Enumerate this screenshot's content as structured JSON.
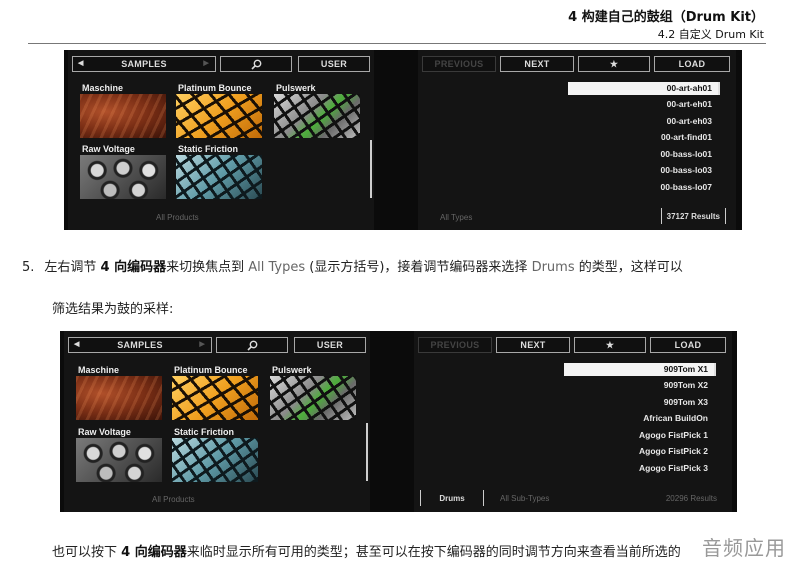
{
  "header": {
    "chapter_title": "4 构建自己的鼓组（Drum Kit）",
    "section_title": "4.2 自定义 Drum Kit"
  },
  "screenshot_1": {
    "left": {
      "samples_button": "SAMPLES",
      "search_icon": "search-icon",
      "user_button": "USER",
      "tiles": [
        "Maschine",
        "Platinum Bounce",
        "Pulswerk",
        "Raw Voltage",
        "Static Friction"
      ],
      "footer": "All Products"
    },
    "right": {
      "previous_button": "PREVIOUS",
      "next_button": "NEXT",
      "star_button": "★",
      "load_button": "LOAD",
      "results_list": [
        "00-art-ah01",
        "00-art-eh01",
        "00-art-eh03",
        "00-art-find01",
        "00-bass-lo01",
        "00-bass-lo03",
        "00-bass-lo07"
      ],
      "selected_index": 0,
      "type_filter": "All Types",
      "results_count": "37127 Results"
    }
  },
  "step5": {
    "number": "5.",
    "text_a": "左右调节 ",
    "bold_a": "4 向编码器",
    "text_b": "来切换焦点到 ",
    "gray_a": "All Types",
    "text_c": " (显示方括号)，接着调节编码器来选择 ",
    "gray_b": "Drums",
    "text_d": "  的类型，这样可以",
    "line2": "筛选结果为鼓的采样:"
  },
  "screenshot_2": {
    "left": {
      "samples_button": "SAMPLES",
      "search_icon": "search-icon",
      "user_button": "USER",
      "tiles": [
        "Maschine",
        "Platinum Bounce",
        "Pulswerk",
        "Raw Voltage",
        "Static Friction"
      ],
      "footer": "All Products"
    },
    "right": {
      "previous_button": "PREVIOUS",
      "next_button": "NEXT",
      "star_button": "★",
      "load_button": "LOAD",
      "results_list": [
        "909Tom X1",
        "909Tom X2",
        "909Tom X3",
        "African BuildOn",
        "Agogo FistPick 1",
        "Agogo FistPick 2",
        "Agogo FistPick 3"
      ],
      "selected_index": 0,
      "type_filter": "Drums",
      "subtype_filter": "All Sub-Types",
      "results_count": "20296 Results"
    }
  },
  "bottom_para": {
    "text_a": "也可以按下 ",
    "bold_a": "4 向编码器",
    "text_b": "来临时显示所有可用的类型；甚至可以在按下编码器的同时调节方向来查看当前所选的"
  },
  "watermark": "音频应用"
}
